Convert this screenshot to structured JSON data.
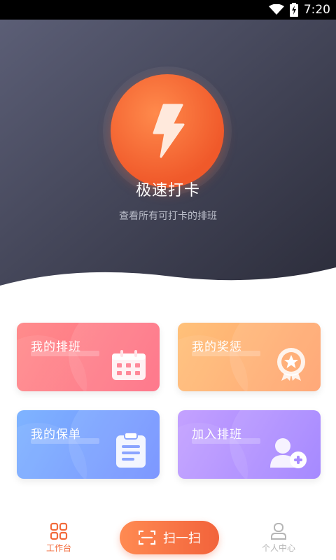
{
  "status_bar": {
    "time": "7:20",
    "icons": [
      "wifi-icon",
      "battery-charging-icon"
    ]
  },
  "hero": {
    "title": "极速打卡",
    "subtitle": "查看所有可打卡的排班",
    "icon": "lightning-bolt-icon",
    "colors": {
      "bg_top": "#5a5d73",
      "bg_bottom": "#2f3040",
      "accent": "#f0592a"
    }
  },
  "cards": [
    {
      "label": "我的排班",
      "icon": "calendar-icon",
      "color": "#fe6a80"
    },
    {
      "label": "我的奖惩",
      "icon": "medal-icon",
      "color": "#ffa46c"
    },
    {
      "label": "我的保单",
      "icon": "clipboard-icon",
      "color": "#6f8cff"
    },
    {
      "label": "加入排班",
      "icon": "user-add-icon",
      "color": "#9c7cff"
    }
  ],
  "tabbar": {
    "workbench": {
      "label": "工作台",
      "icon": "grid-icon",
      "active": true
    },
    "scan": {
      "label": "扫一扫",
      "icon": "scan-icon"
    },
    "profile": {
      "label": "个人中心",
      "icon": "user-icon",
      "active": false
    }
  }
}
